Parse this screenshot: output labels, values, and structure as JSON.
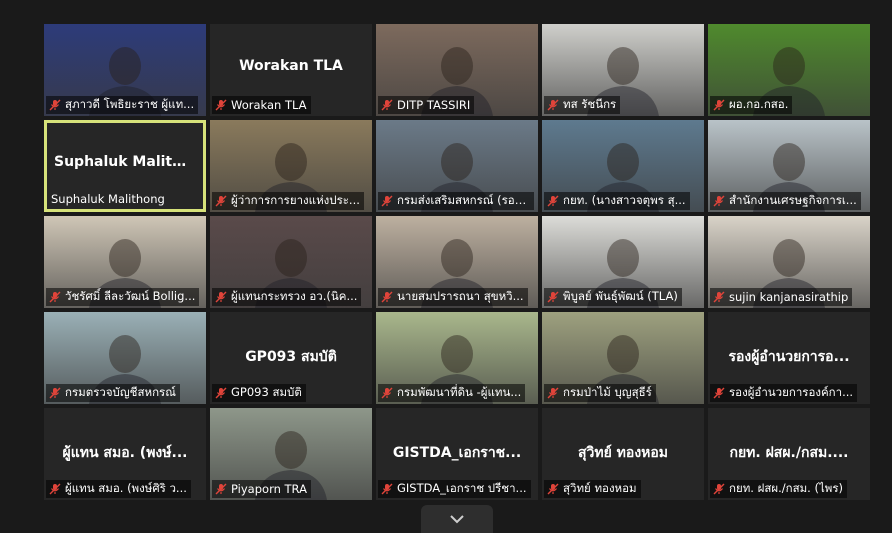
{
  "tiles": [
    {
      "label": "สุภาวดี โพธิยะราช ผู้แท...",
      "big": "",
      "muted": true,
      "bg": "#2d3b7a"
    },
    {
      "label": "Worakan TLA",
      "big": "Worakan TLA",
      "muted": true,
      "bg": ""
    },
    {
      "label": "DITP TASSIRI",
      "big": "",
      "muted": true,
      "bg": "#7d6a5d"
    },
    {
      "label": "ทส รัชนีกร",
      "big": "",
      "muted": true,
      "bg": "#cfcfcb"
    },
    {
      "label": "ผอ.กอ.กสอ.",
      "big": "",
      "muted": true,
      "bg": "#4f8a2d"
    },
    {
      "label": "Suphaluk Malithong",
      "big": "Suphaluk Malith...",
      "muted": false,
      "bg": ""
    },
    {
      "label": "ผู้ว่าการการยางแห่งประ...",
      "big": "",
      "muted": true,
      "bg": "#8a7a5c"
    },
    {
      "label": "กรมส่งเสริมสหกรณ์ (รองอ...",
      "big": "",
      "muted": true,
      "bg": "#6b7a88"
    },
    {
      "label": "กยท. (นางสาวจตุพร สุ...",
      "big": "",
      "muted": true,
      "bg": "#5e7a8f"
    },
    {
      "label": "สำนักงานเศรษฐกิจการเ...",
      "big": "",
      "muted": true,
      "bg": "#b9c3c8"
    },
    {
      "label": "วัชรัศมิ์ ลีละวัฒน์ Bollig...",
      "big": "",
      "muted": true,
      "bg": "#cfc6b6"
    },
    {
      "label": "ผู้แทนกระทรวง อว.(นิค...",
      "big": "",
      "muted": true,
      "bg": "#5a4a4a"
    },
    {
      "label": "นายสมปรารถนา สุขหวิ...",
      "big": "",
      "muted": true,
      "bg": "#bdb0a0"
    },
    {
      "label": "พิบูลย์ พันธุ์พัฒน์ (TLA)",
      "big": "",
      "muted": true,
      "bg": "#dcdcd8"
    },
    {
      "label": "sujin kanjanasirathip",
      "big": "",
      "muted": true,
      "bg": "#d9d3c8"
    },
    {
      "label": "กรมตรวจบัญชีสหกรณ์",
      "big": "",
      "muted": true,
      "bg": "#9ab0b6"
    },
    {
      "label": "GP093 สมบัติ",
      "big": "GP093 สมบัติ",
      "muted": true,
      "bg": ""
    },
    {
      "label": "กรมพัฒนาที่ดิน -ผู้แทน...",
      "big": "",
      "muted": true,
      "bg": "#a9b78c"
    },
    {
      "label": "กรมป่าไม้ บุญสุธีร์",
      "big": "",
      "muted": true,
      "bg": "#9ea17f"
    },
    {
      "label": "รองผู้อำนวยการองค์กา...",
      "big": "รองผู้อำนวยการอ...",
      "muted": true,
      "bg": ""
    },
    {
      "label": "ผู้แทน สมอ. (พงษ์ศิริ ว...",
      "big": "ผู้แทน สมอ. (พงษ์...",
      "muted": true,
      "bg": ""
    },
    {
      "label": "Piyaporn TRA",
      "big": "",
      "muted": true,
      "bg": "#8e978a"
    },
    {
      "label": "GISTDA_เอกราช ปรีชา...",
      "big": "GISTDA_เอกราช...",
      "muted": true,
      "bg": ""
    },
    {
      "label": "สุวิทย์ ทองหอม",
      "big": "สุวิทย์ ทองหอม",
      "muted": true,
      "bg": ""
    },
    {
      "label": "กยท. ฝสผ./กสม. (ไพร)",
      "big": "กยท. ฝสผ./กสม....",
      "muted": true,
      "bg": ""
    }
  ],
  "colors": {
    "active_border": "#d6e27a",
    "mute_icon": "#e0443a",
    "tile_bg": "#262626"
  }
}
